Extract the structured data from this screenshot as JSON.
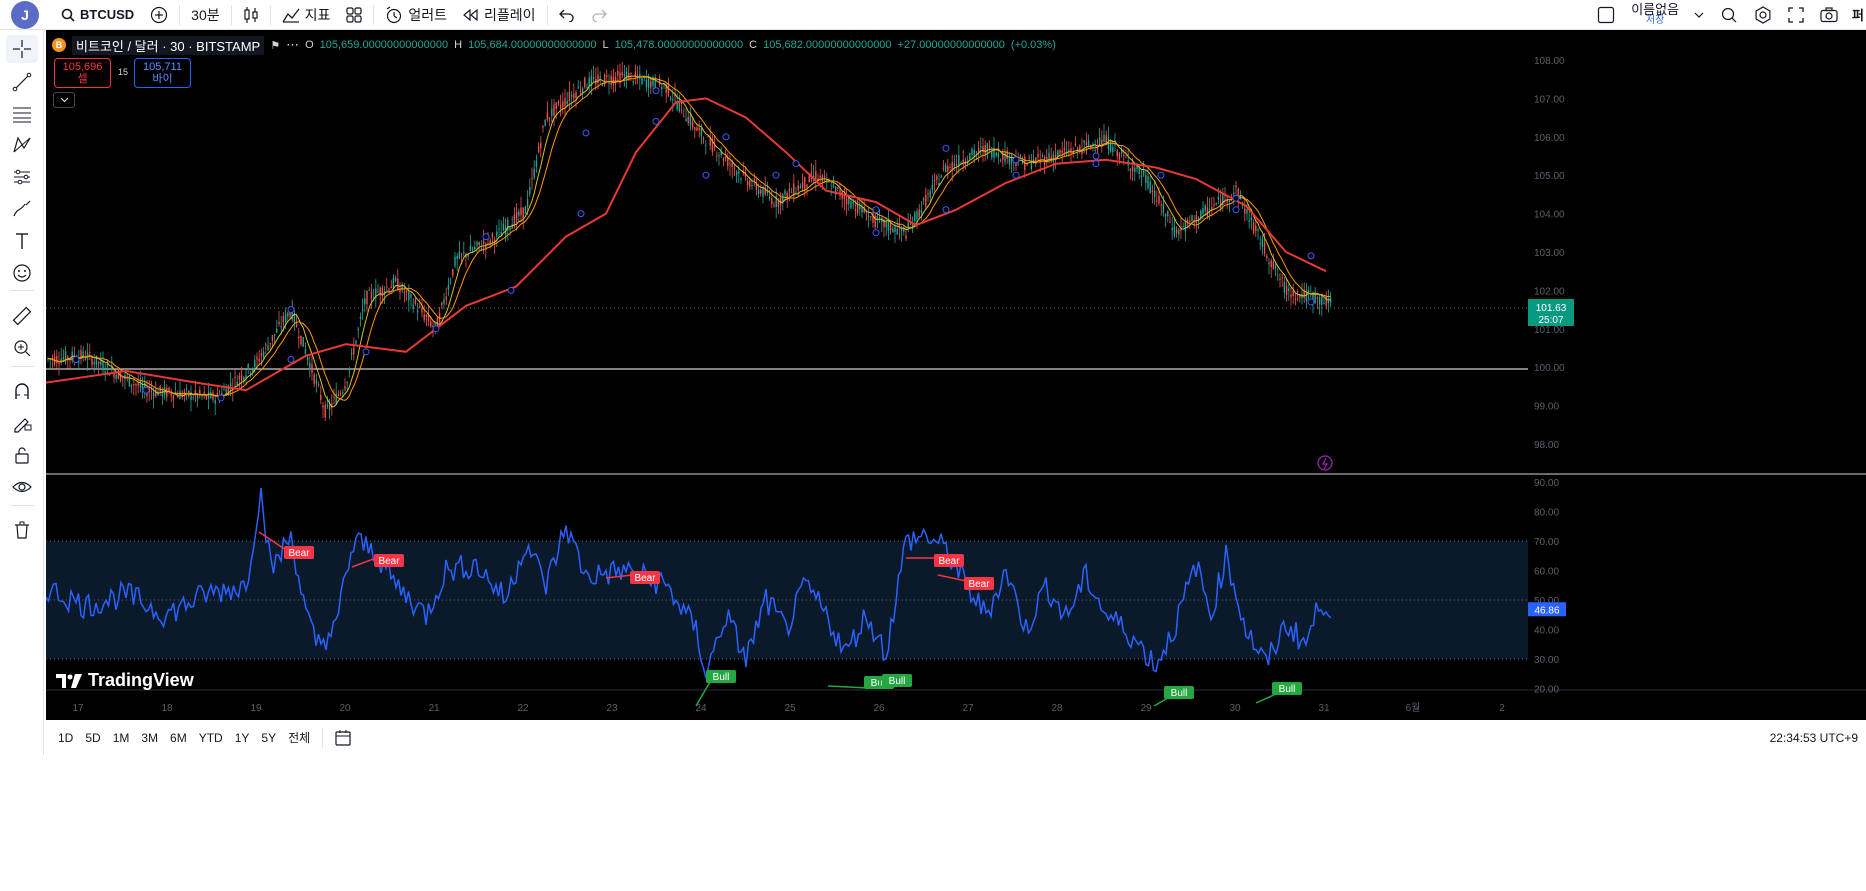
{
  "topbar": {
    "avatar_letter": "J",
    "symbol": "BTCUSD",
    "interval": "30분",
    "indicators_label": "지표",
    "alerts_label": "얼러트",
    "replay_label": "리플레이",
    "layout_name": "이름없음",
    "layout_sub": "저장",
    "publish_partial": "퍼"
  },
  "lefttools": {
    "icons": [
      "crosshair-icon",
      "trend-line-icon",
      "fib-icon",
      "pattern-icon",
      "prediction-icon",
      "brush-icon",
      "text-icon",
      "emoji-icon",
      "ruler-icon",
      "zoom-in-icon",
      "magnet-icon",
      "lock-drawing-icon",
      "lock-icon",
      "eye-icon",
      "trash-icon"
    ]
  },
  "legend": {
    "coin_badge": "B",
    "title": "비트코인 / 달러 · 30 · BITSTAMP",
    "open": "105,659.00000000000000",
    "high": "105,684.00000000000000",
    "low": "105,478.00000000000000",
    "close": "105,682.00000000000000",
    "change": "+27.00000000000000",
    "change_pct": "(+0.03%)",
    "sell_price": "105,696",
    "sell_label": "셀",
    "buy_price": "105,711",
    "buy_label": "바이",
    "spread": "15"
  },
  "price_axis": {
    "ticks": [
      "108.00",
      "107.00",
      "106.00",
      "105.00",
      "104.00",
      "103.00",
      "102.00",
      "101.00",
      "100.00",
      "99.00",
      "98.00"
    ],
    "last_price": "101.63",
    "countdown": "25:07"
  },
  "rsi_axis": {
    "ticks": [
      "90.00",
      "80.00",
      "70.00",
      "60.00",
      "50.00",
      "40.00",
      "30.00",
      "20.00"
    ],
    "last_value": "46.86"
  },
  "time_axis": {
    "ticks": [
      "17",
      "18",
      "19",
      "20",
      "21",
      "22",
      "23",
      "24",
      "25",
      "26",
      "27",
      "28",
      "29",
      "30",
      "31",
      "6월",
      "2"
    ]
  },
  "signals": {
    "bear_label": "Bear",
    "bull_label": "Bull"
  },
  "colors": {
    "price_ma_red": "#e53935",
    "price_ma_orange": "#ff9800",
    "price_ma_yellow": "#d9c030",
    "rsi_line": "#2962ff",
    "bear_bg": "#f23645",
    "bull_bg": "#26a641",
    "last_price_bg": "#089981"
  },
  "watermark": "TradingView",
  "bottombar": {
    "ranges": [
      "1D",
      "5D",
      "1M",
      "3M",
      "6M",
      "YTD",
      "1Y",
      "5Y",
      "전체"
    ],
    "clock": "22:34:53 UTC+9"
  }
}
